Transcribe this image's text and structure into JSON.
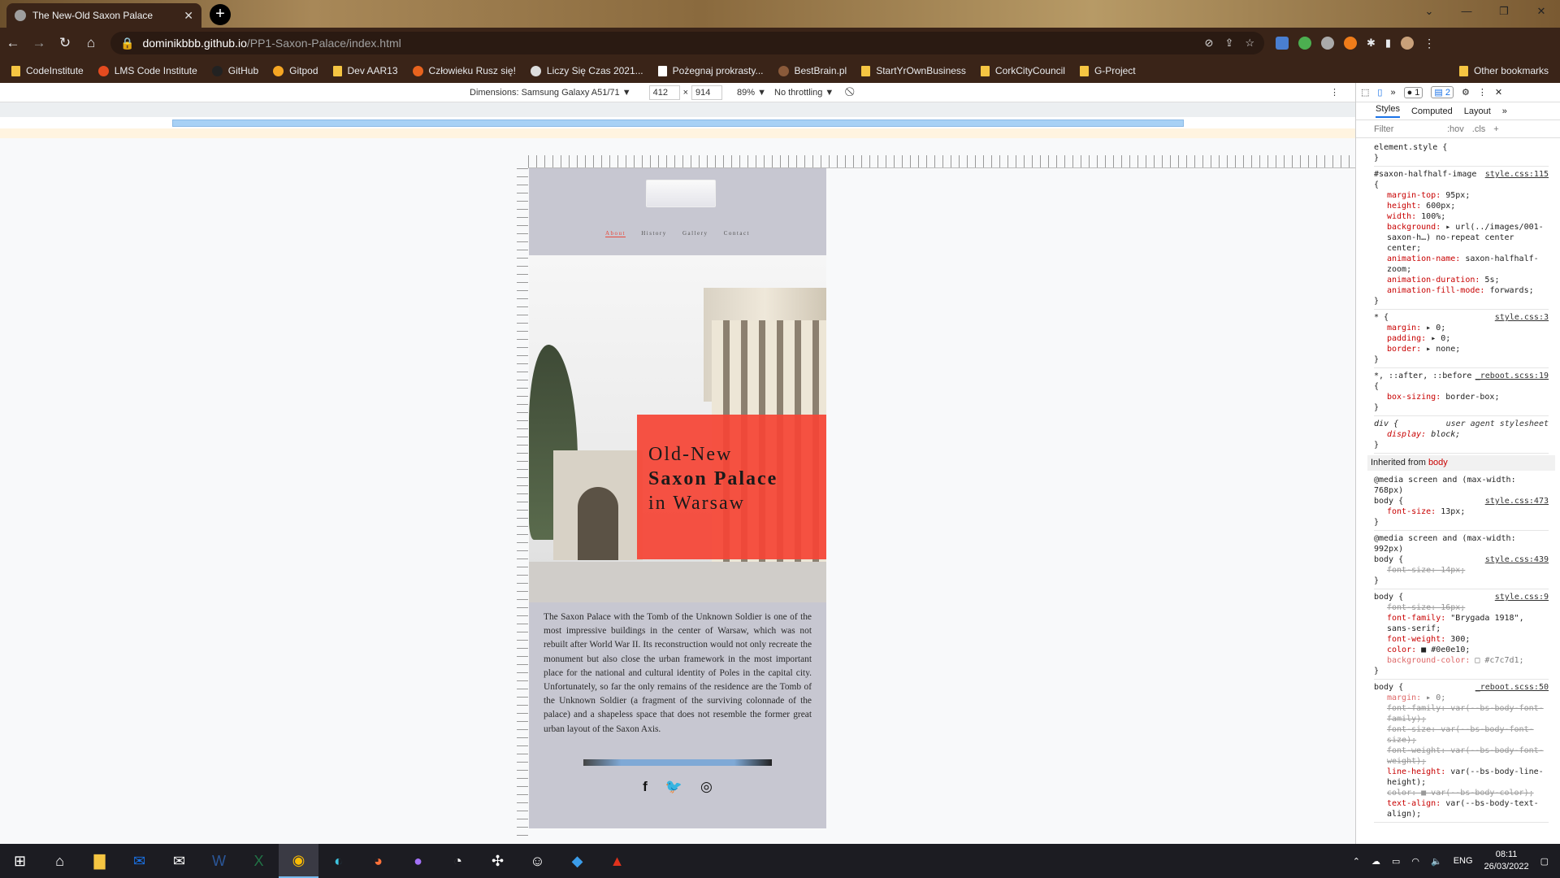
{
  "browser": {
    "tab_title": "The New-Old Saxon Palace",
    "url_host": "dominikbbb.github.io",
    "url_path": "/PP1-Saxon-Palace/index.html",
    "bookmarks": [
      "CodeInstitute",
      "LMS Code Institute",
      "GitHub",
      "Gitpod",
      "Dev AAR13",
      "Człowieku Rusz się!",
      "Liczy Się Czas 2021...",
      "Pożegnaj prokrasty...",
      "BestBrain.pl",
      "StartYrOwnBusiness",
      "CorkCityCouncil",
      "G-Project"
    ],
    "other_bookmarks": "Other bookmarks"
  },
  "device_toolbar": {
    "dimensions": "Dimensions: Samsung Galaxy A51/71 ▼",
    "width": "412",
    "height": "914",
    "zoom": "89% ▼",
    "throttling": "No throttling ▼"
  },
  "site": {
    "nav": [
      "About",
      "History",
      "Gallery",
      "Contact"
    ],
    "hero_line1": "Old-New",
    "hero_line2": "Saxon Palace",
    "hero_line3": "in Warsaw",
    "intro": "The Saxon Palace with the Tomb of the Unknown Soldier is one of the most impressive buildings in the center of Warsaw, which was not rebuilt after World War II. Its reconstruction would not only recreate the monument but also close the urban framework in the most important place for the national and cultural identity of Poles in the capital city. Unfortunately, so far the only remains of the residence are the Tomb of the Unknown Soldier (a fragment of the surviving colonnade of the palace) and a shapeless space that does not resemble the former great urban layout of the Saxon Axis.",
    "social_icons": [
      "facebook-icon",
      "twitter-icon",
      "instagram-icon"
    ]
  },
  "devtools": {
    "tabs": [
      "Styles",
      "Computed",
      "Layout"
    ],
    "filter": "Filter",
    "hov": ":hov",
    "cls": ".cls",
    "badge_errors": "1",
    "badge_messages": "2",
    "inherited_label": "Inherited from",
    "inherited_target": "body"
  },
  "taskbar": {
    "lang": "ENG",
    "time": "08:11",
    "date": "26/03/2022"
  },
  "colors": {
    "accent_red": "#f54536",
    "page_bg": "#c7c7d1",
    "chrome_dark": "#3a2418"
  }
}
